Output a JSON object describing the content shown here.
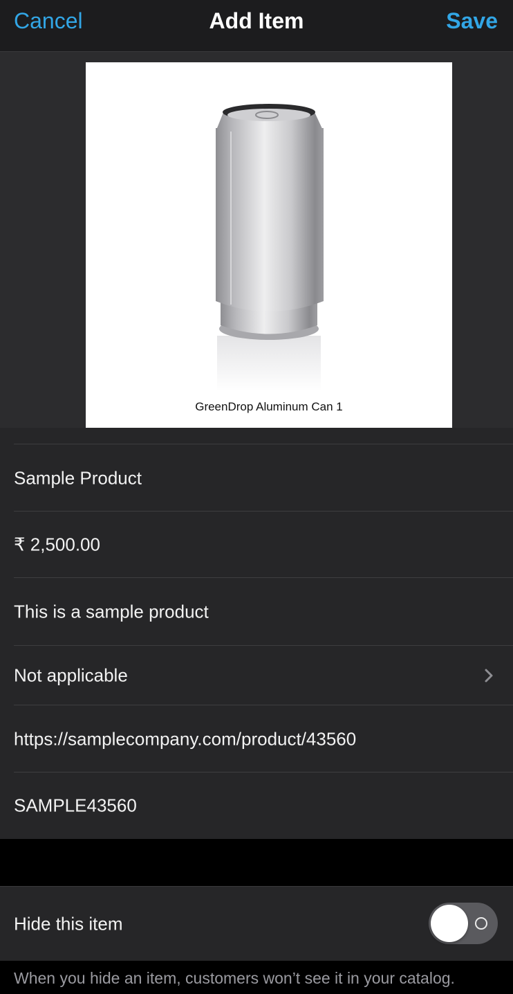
{
  "nav": {
    "cancel_label": "Cancel",
    "title": "Add Item",
    "save_label": "Save"
  },
  "photo": {
    "caption": "GreenDrop Aluminum Can 1"
  },
  "fields": {
    "name": "Sample Product",
    "price": "₹ 2,500.00",
    "description": "This is a sample product",
    "category": "Not applicable",
    "link": "https://samplecompany.com/product/43560",
    "sku": "SAMPLE43560"
  },
  "visibility": {
    "label": "Hide this item",
    "enabled": false,
    "footer": "When you hide an item, customers won’t see it in your catalog."
  },
  "colors": {
    "accent": "#32a6e6",
    "background": "#000000",
    "cell": "#262628"
  },
  "icons": [
    "chevron-right-icon"
  ]
}
